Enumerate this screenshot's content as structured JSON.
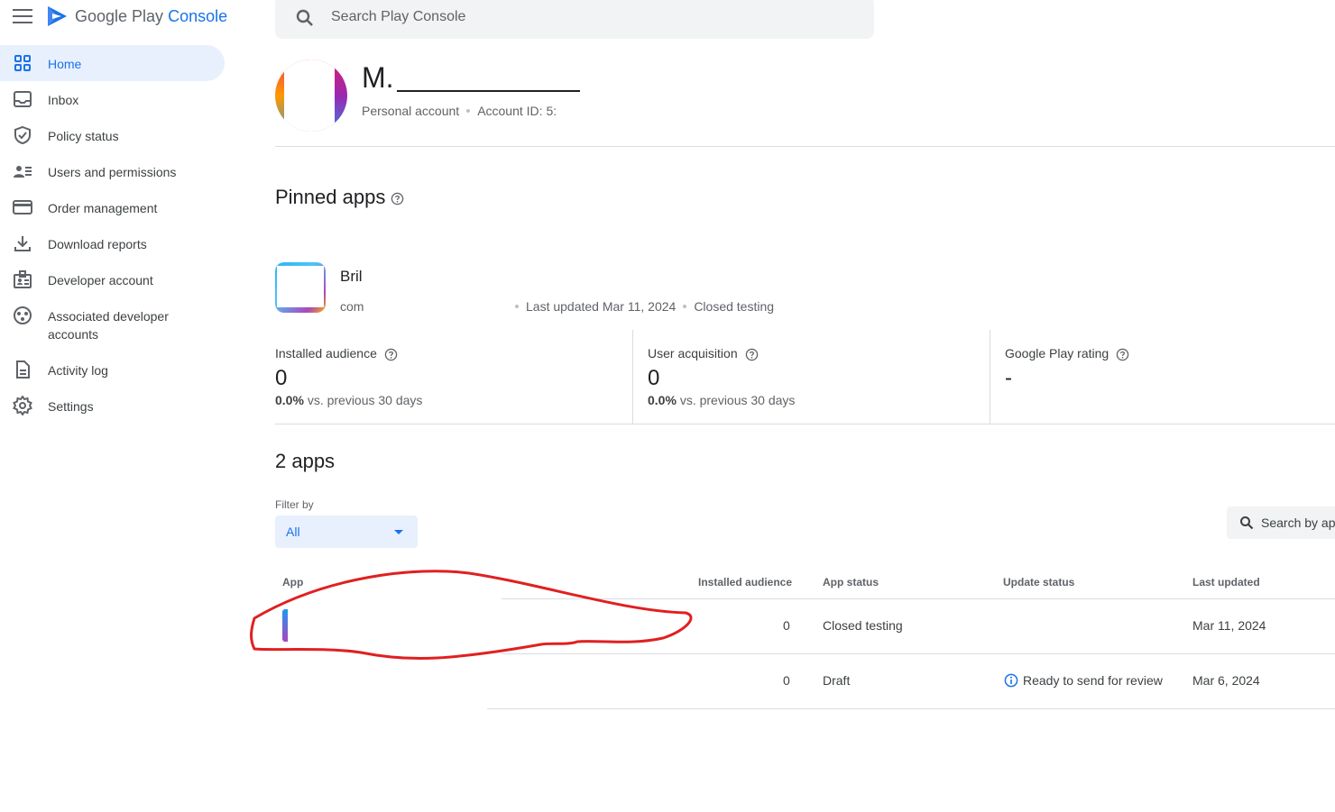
{
  "brand": {
    "name": "Google Play",
    "accent": "Console"
  },
  "search": {
    "placeholder": "Search Play Console"
  },
  "sidebar": {
    "items": [
      {
        "label": "Home",
        "icon": "grid-icon",
        "active": true
      },
      {
        "label": "Inbox",
        "icon": "inbox-icon"
      },
      {
        "label": "Policy status",
        "icon": "shield-icon"
      },
      {
        "label": "Users and permissions",
        "icon": "users-icon"
      },
      {
        "label": "Order management",
        "icon": "credit-card-icon"
      },
      {
        "label": "Download reports",
        "icon": "download-icon"
      },
      {
        "label": "Developer account",
        "icon": "badge-icon"
      },
      {
        "label": "Associated developer accounts",
        "icon": "linked-accounts-icon"
      },
      {
        "label": "Activity log",
        "icon": "document-icon"
      },
      {
        "label": "Settings",
        "icon": "gear-icon"
      }
    ]
  },
  "account": {
    "name": "M.",
    "type": "Personal account",
    "id_label": "Account ID: 5:"
  },
  "pinned": {
    "title": "Pinned apps",
    "app": {
      "name": "Bril",
      "package": "com",
      "last_updated": "Last updated Mar 11, 2024",
      "status": "Closed testing"
    },
    "stats": [
      {
        "label": "Installed audience",
        "value": "0",
        "change": "0.0%",
        "change_suffix": "vs. previous 30 days"
      },
      {
        "label": "User acquisition",
        "value": "0",
        "change": "0.0%",
        "change_suffix": "vs. previous 30 days"
      },
      {
        "label": "Google Play rating",
        "value": "-"
      }
    ]
  },
  "apps": {
    "title": "2 apps",
    "filter_label": "Filter by",
    "filter_value": "All",
    "search_placeholder": "Search by ap",
    "columns": [
      "App",
      "Installed audience",
      "App status",
      "Update status",
      "Last updated"
    ],
    "rows": [
      {
        "installed": "0",
        "status": "Closed testing",
        "update_status": "",
        "last_updated": "Mar 11, 2024"
      },
      {
        "installed": "0",
        "status": "Draft",
        "update_status": "Ready to send for review",
        "last_updated": "Mar 6, 2024"
      }
    ]
  },
  "colors": {
    "accent": "#1a73e8",
    "active_bg": "#e8f0fe",
    "annotation": "#e02020"
  }
}
